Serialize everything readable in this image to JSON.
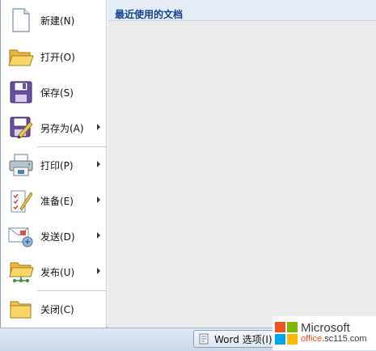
{
  "menu": {
    "items": [
      {
        "label": "新建(N)",
        "icon": "new-document-icon",
        "submenu": false
      },
      {
        "label": "打开(O)",
        "icon": "open-folder-icon",
        "submenu": false
      },
      {
        "label": "保存(S)",
        "icon": "save-disk-icon",
        "submenu": false
      },
      {
        "label": "另存为(A)",
        "icon": "save-as-icon",
        "submenu": true
      },
      {
        "label": "打印(P)",
        "icon": "printer-icon",
        "submenu": true
      },
      {
        "label": "准备(E)",
        "icon": "prepare-icon",
        "submenu": true
      },
      {
        "label": "发送(D)",
        "icon": "send-icon",
        "submenu": true
      },
      {
        "label": "发布(U)",
        "icon": "publish-icon",
        "submenu": true
      },
      {
        "label": "关闭(C)",
        "icon": "close-folder-icon",
        "submenu": false
      }
    ]
  },
  "recent": {
    "title": "最近使用的文档"
  },
  "footer": {
    "options_label": "Word 选项(I)"
  },
  "watermark": {
    "brand": "Microsoft",
    "url_prefix": "office",
    "url_rest": ".sc115.com"
  },
  "colors": {
    "accent": "#15428b",
    "ms_red": "#f25022",
    "ms_green": "#7fba00",
    "ms_blue": "#00a4ef",
    "ms_yellow": "#ffb900"
  }
}
